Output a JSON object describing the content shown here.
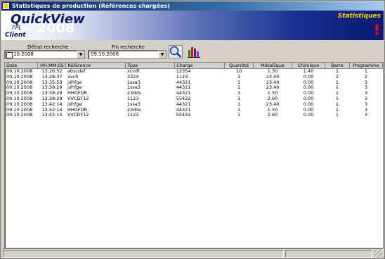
{
  "window": {
    "title": "Statistiques de production (Références chargées)"
  },
  "banner": {
    "product": "QuickView",
    "company": "FPL",
    "year": "2008",
    "module": "Client",
    "section": "Statistiques"
  },
  "search": {
    "start_label": "Début recherche",
    "start_value": "10.2008",
    "end_label": "Fin recherche",
    "end_value": "09.10.2008"
  },
  "toolbar": {
    "search_icon": "magnifier-icon",
    "stats_icon": "bar-chart-icon"
  },
  "table": {
    "headers": [
      "Date",
      "HH:MM:SS",
      "Référence",
      "Type",
      "Charge",
      "Quantité",
      "Métallique",
      "Chimique",
      "Barre",
      "Programme"
    ],
    "rows": [
      [
        "09.10.2008",
        "13:26:52",
        "abscdef",
        "xcvdf",
        "12354",
        "10",
        "1.30",
        "1.40",
        "1",
        "1"
      ],
      [
        "09.10.2008",
        "13:28:37",
        "xvch",
        "3324",
        "1123",
        "1",
        "23.40",
        "0.00",
        "2",
        "2"
      ],
      [
        "09.10.2008",
        "13:35:53",
        "jdhfge",
        "1ssa3",
        "44321",
        "1",
        "23.40",
        "0.00",
        "1",
        "3"
      ],
      [
        "09.10.2008",
        "13:38:29",
        "jdhfge",
        "1ssa3",
        "44321",
        "1",
        "23.40",
        "0.00",
        "1",
        "3"
      ],
      [
        "09.10.2008",
        "13:38:29",
        "HHGFDR",
        "23dds",
        "44321",
        "1",
        "1.50",
        "0.00",
        "1",
        "3"
      ],
      [
        "09.10.2008",
        "13:38:29",
        "VVCDF12",
        "1123",
        "55432",
        "1",
        "2.60",
        "0.00",
        "1",
        "3"
      ],
      [
        "09.10.2008",
        "13:42:14",
        "jdhfge",
        "1ssa3",
        "44321",
        "1",
        "23.40",
        "0.00",
        "1",
        "3"
      ],
      [
        "09.10.2008",
        "13:42:14",
        "HHGFDR",
        "23dds",
        "44321",
        "1",
        "1.50",
        "0.00",
        "1",
        "3"
      ],
      [
        "09.10.2008",
        "13:42:14",
        "VVCDF12",
        "1123",
        "55432",
        "1",
        "2.60",
        "0.00",
        "1",
        "3"
      ]
    ]
  }
}
